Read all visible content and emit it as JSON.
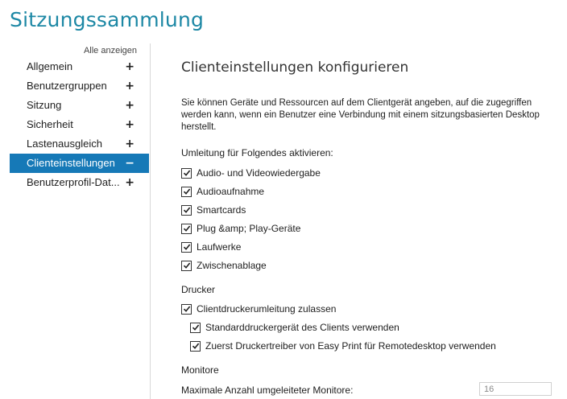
{
  "app": {
    "title": "Sitzungssammlung"
  },
  "sidebar": {
    "show_all": "Alle anzeigen",
    "items": [
      {
        "label": "Allgemein",
        "sign": "+"
      },
      {
        "label": "Benutzergruppen",
        "sign": "+"
      },
      {
        "label": "Sitzung",
        "sign": "+"
      },
      {
        "label": "Sicherheit",
        "sign": "+"
      },
      {
        "label": "Lastenausgleich",
        "sign": "+"
      },
      {
        "label": "Clienteinstellungen",
        "sign": "−",
        "active": true
      },
      {
        "label": "Benutzerprofil-Dat...",
        "sign": "+"
      }
    ]
  },
  "main": {
    "heading": "Clienteinstellungen konfigurieren",
    "description": "Sie können Geräte und Ressourcen auf dem Clientgerät angeben, auf die zugegriffen werden kann, wenn ein Benutzer eine Verbindung mit einem sitzungsbasierten Desktop herstellt.",
    "redirect_label": "Umleitung für Folgendes aktivieren:",
    "redirect_options": [
      {
        "label": "Audio- und Videowiedergabe",
        "checked": true
      },
      {
        "label": "Audioaufnahme",
        "checked": true
      },
      {
        "label": "Smartcards",
        "checked": true
      },
      {
        "label": "Plug &amp; Play-Geräte",
        "checked": true
      },
      {
        "label": "Laufwerke",
        "checked": true
      },
      {
        "label": "Zwischenablage",
        "checked": true
      }
    ],
    "printer_label": "Drucker",
    "printer_options": [
      {
        "label": "Clientdruckerumleitung zulassen",
        "checked": true
      },
      {
        "label": "Standarddruckergerät des Clients verwenden",
        "checked": true
      },
      {
        "label": "Zuerst Druckertreiber von Easy Print für Remotedesktop verwenden",
        "checked": true
      }
    ],
    "monitors_label": "Monitore",
    "max_monitors_label": "Maximale Anzahl umgeleiteter Monitore:",
    "max_monitors_value": "16"
  }
}
